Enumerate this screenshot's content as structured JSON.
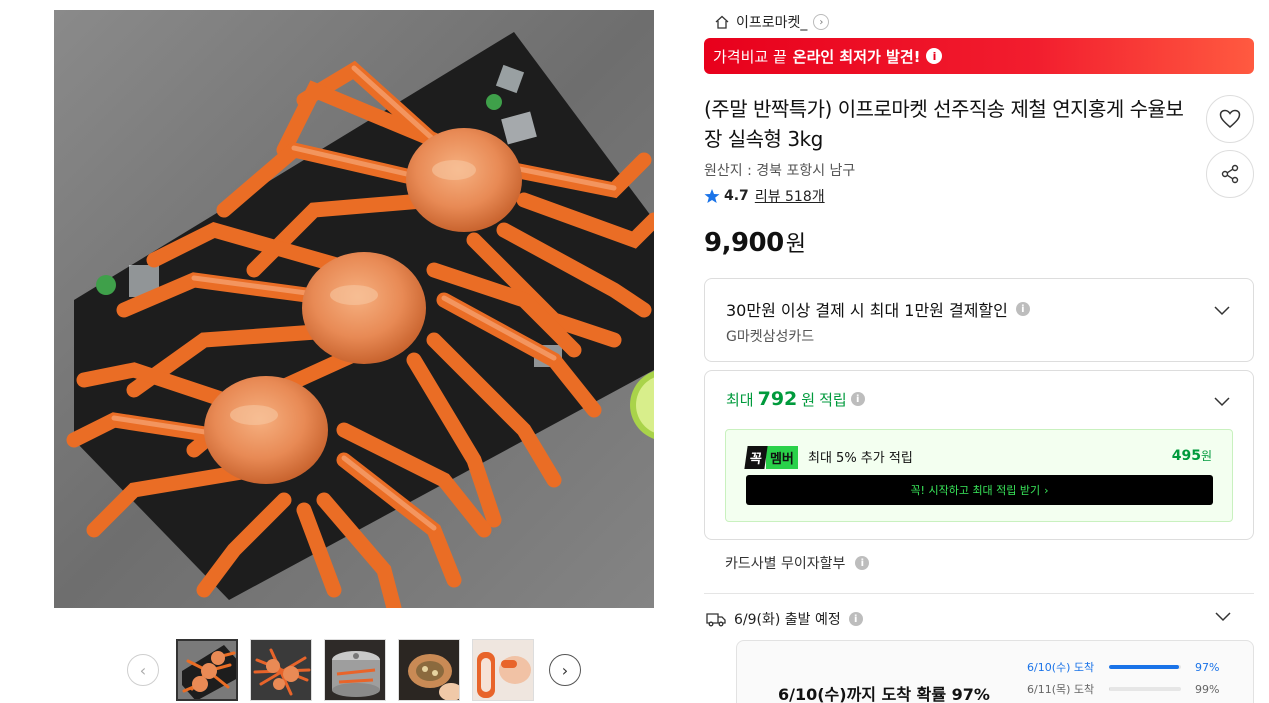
{
  "gallery": {
    "thumbnails": [
      {
        "icon": "crab-plate-thumbnail",
        "selected": true
      },
      {
        "icon": "crab-pile-thumbnail",
        "selected": false
      },
      {
        "icon": "steamer-pot-thumbnail",
        "selected": false
      },
      {
        "icon": "crab-shell-thumbnail",
        "selected": false
      },
      {
        "icon": "crab-leg-hand-thumbnail",
        "selected": false
      }
    ]
  },
  "store": {
    "name": "이프로마켓_"
  },
  "banner": {
    "prefix": "가격비교 끝",
    "highlight": "온라인 최저가 발견!",
    "info_glyph": "i"
  },
  "product": {
    "title": "(주말 반짝특가) 이프로마켓 선주직송 제철 연지홍게 수율보장 실속형 3kg",
    "origin": "원산지 : 경북 포항시 남구",
    "rating": "4.7",
    "review": "리뷰 518개",
    "price": "9,900",
    "currency": "원"
  },
  "discount": {
    "title": "30만원 이상 결제 시 최대 1만원 결제할인",
    "card": "G마켓삼성카드"
  },
  "points": {
    "prefix": "최대",
    "amount": "792",
    "unit": "원",
    "suffix": "적립",
    "member": {
      "badge_black": "꼭",
      "badge_green": "멤버",
      "text": "최대 5% 추가 적립",
      "amount": "495",
      "unit": "원",
      "button": "꼭! 시작하고 최대 적립 받기",
      "button_arrow": "›"
    }
  },
  "installment": {
    "label": "카드사별 무이자할부"
  },
  "shipping": {
    "label": "6/9(화) 출발 예정",
    "arrival_main": "6/10(수)까지 도착 확률 97%",
    "rows": [
      {
        "date": "6/10(수) 도착",
        "percent": "97%",
        "fill": 0.97
      },
      {
        "date": "6/11(목) 도착",
        "percent": "99%",
        "fill": 0.02
      }
    ]
  },
  "colors": {
    "banner_red": "#e8001c",
    "points_green": "#009a3c",
    "member_green": "#2ad14a",
    "arrival_blue": "#1a73e8"
  }
}
